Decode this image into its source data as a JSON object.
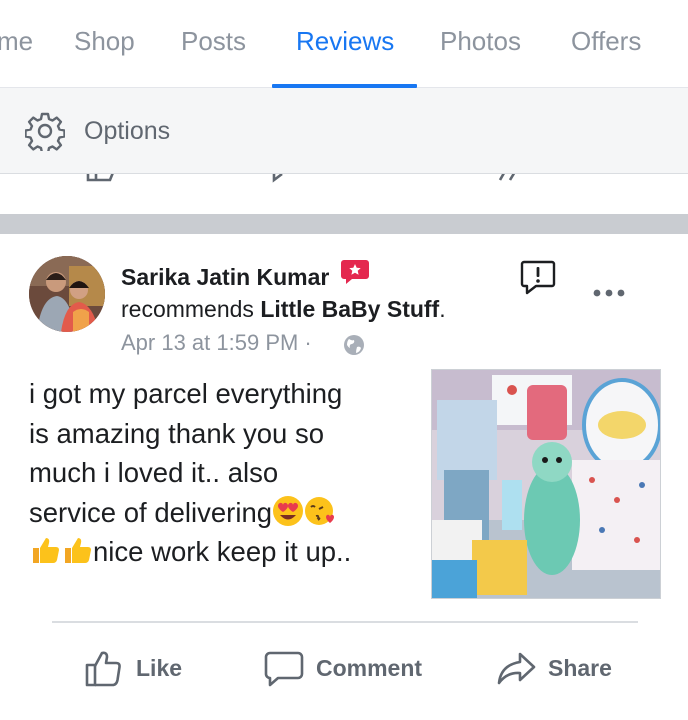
{
  "tabs": [
    {
      "label": "me",
      "active": false
    },
    {
      "label": "Shop",
      "active": false
    },
    {
      "label": "Posts",
      "active": false
    },
    {
      "label": "Reviews",
      "active": true
    },
    {
      "label": "Photos",
      "active": false
    },
    {
      "label": "Offers",
      "active": false
    }
  ],
  "options": {
    "label": "Options",
    "icon": "gear-icon"
  },
  "post": {
    "author": "Sarika Jatin Kumar",
    "recommends_prefix": "recommends ",
    "page_name": "Little BaBy Stuff",
    "recommends_suffix": ".",
    "timestamp": "Apr 13 at 1:59 PM ·",
    "privacy_icon": "globe-icon",
    "review_lines": [
      "i got my parcel everything",
      "is amazing thank you so",
      "much i loved it.. also",
      "service of delivering",
      "nice work keep it up.."
    ],
    "emojis": [
      "heart-eyes-emoji",
      "kiss-emoji",
      "thumbs-up-emoji",
      "thumbs-up-emoji"
    ]
  },
  "actions": {
    "like": "Like",
    "comment": "Comment",
    "share": "Share"
  },
  "colors": {
    "accent": "#1877f2",
    "muted": "#8d949e",
    "action_text": "#606770",
    "separator": "#c9ccd1",
    "badge": "#e4284f"
  }
}
